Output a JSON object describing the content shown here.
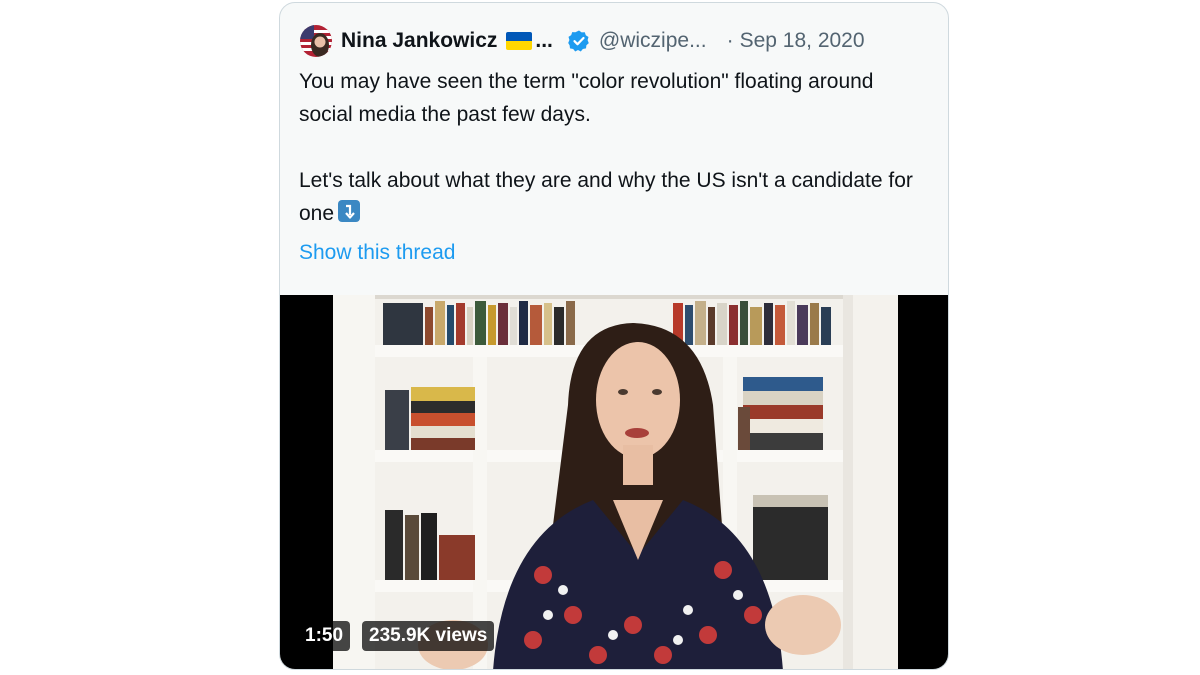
{
  "tweet": {
    "author_name": "Nina Jankowicz",
    "name_ellipsis": "...",
    "handle": "@wiczipe...",
    "separator": "·",
    "date": "Sep 18, 2020",
    "paragraphs": [
      "You may have seen the term \"color revolution\" floating around social media the past few days.",
      "Let's talk about what they are and why the US isn't a candidate for one"
    ],
    "show_thread_label": "Show this thread",
    "colors": {
      "link": "#1d9bf0",
      "verified": "#1d9bf0",
      "text": "#0f1419",
      "muted": "#536471"
    },
    "icons": {
      "avatar": "avatar",
      "flag": "ukraine-flag-icon",
      "verified": "verified-badge-icon",
      "arrow": "arrow-down-right-emoji-icon"
    }
  },
  "video": {
    "duration": "1:50",
    "views": "235.9K views"
  }
}
